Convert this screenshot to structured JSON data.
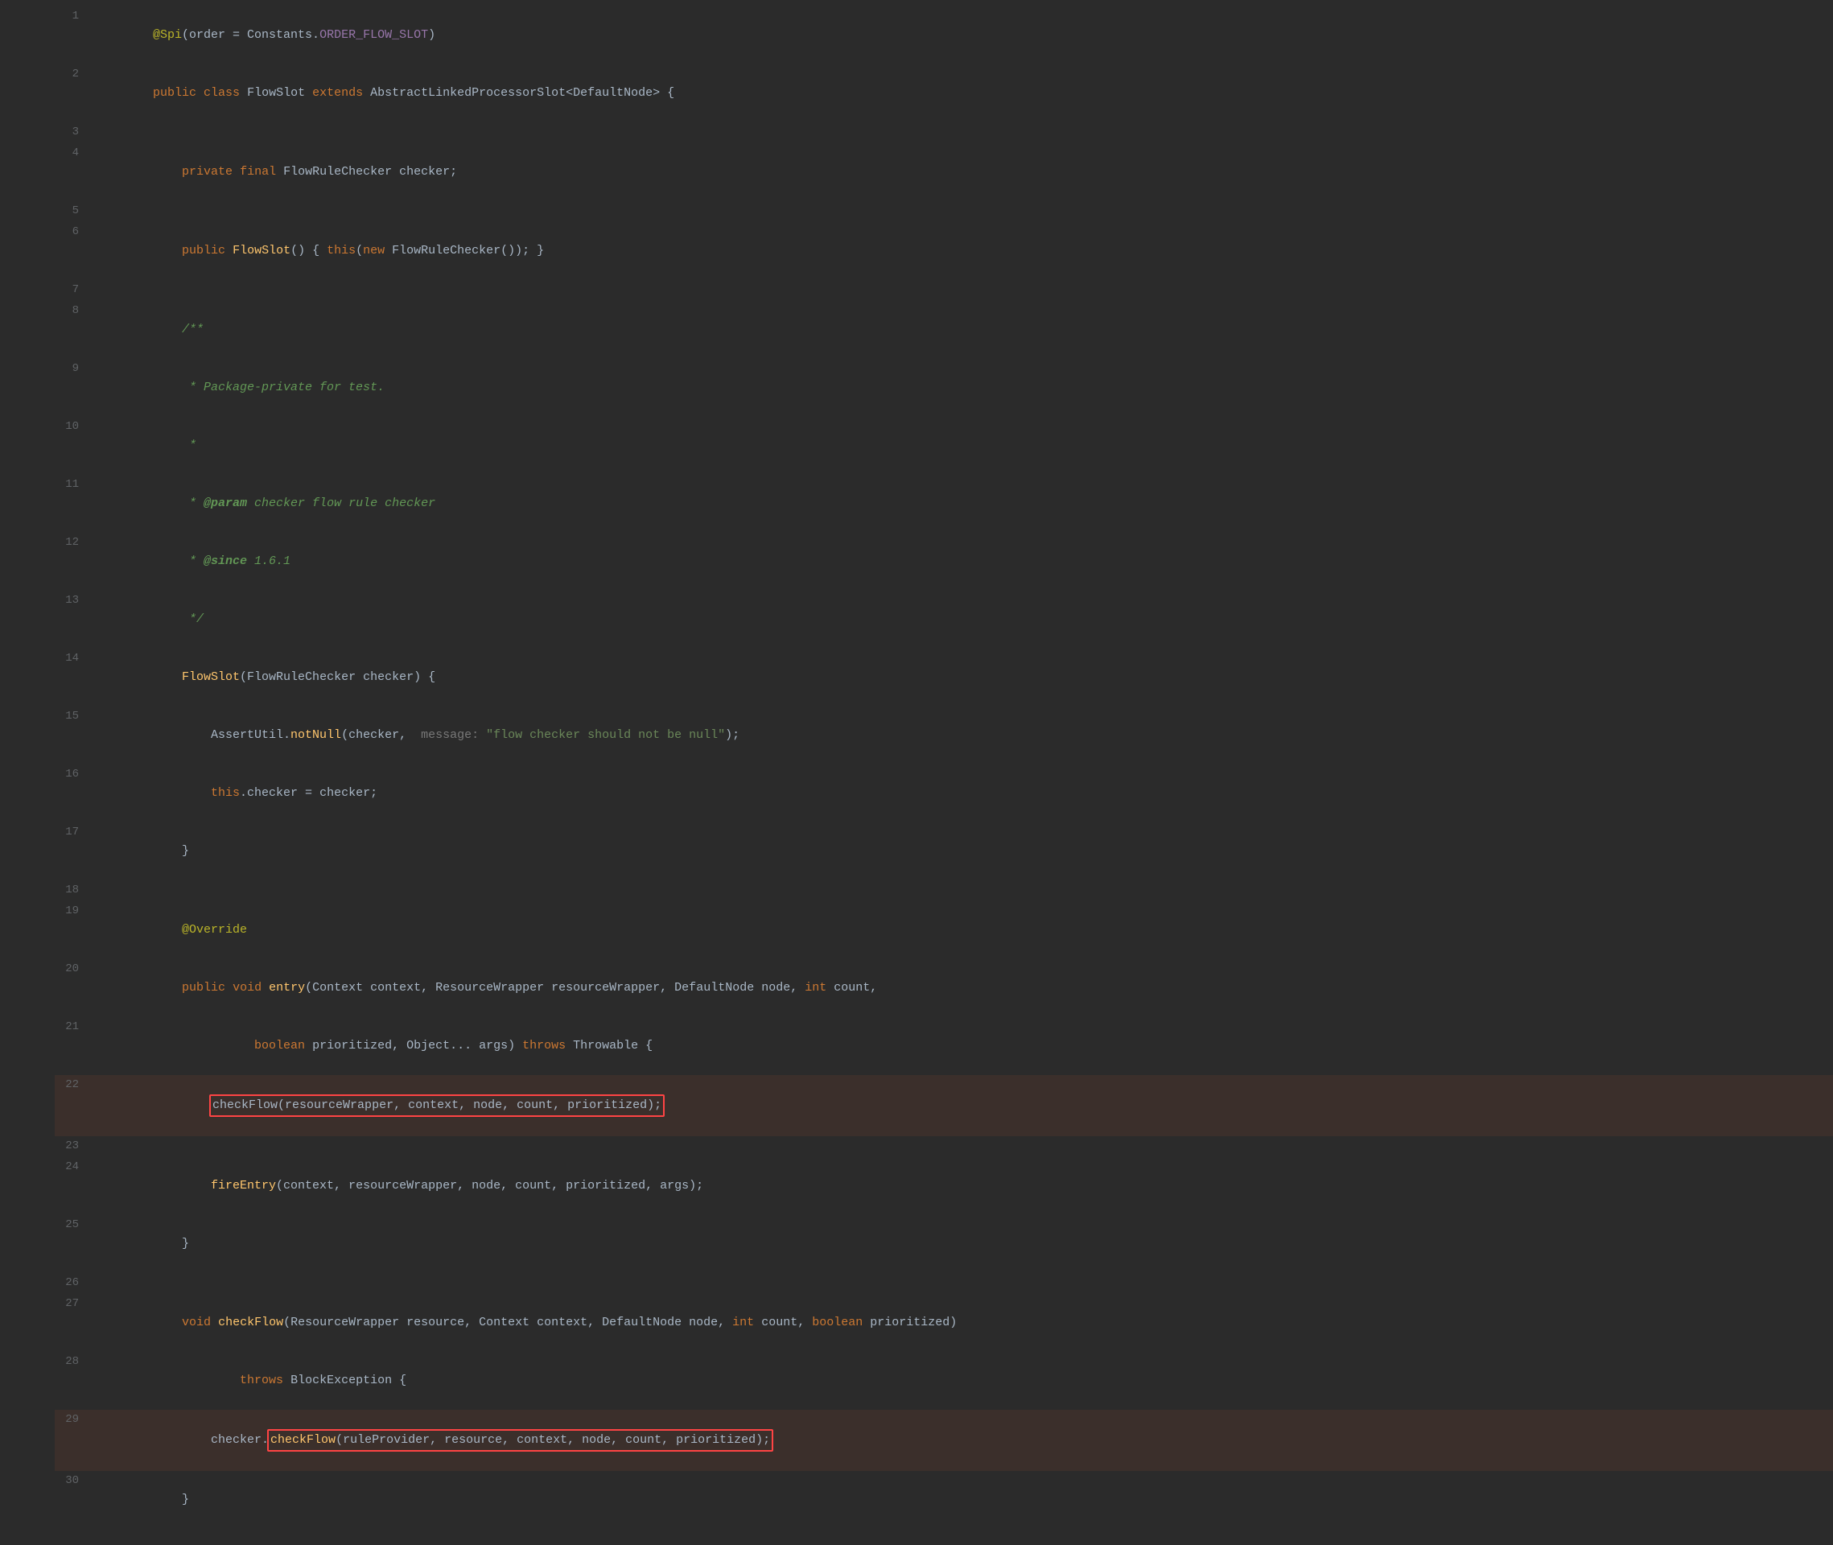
{
  "editor": {
    "background": "#2b2b2b",
    "lines": [
      {
        "num": 1,
        "tokens": [
          {
            "text": "@Spi",
            "cls": "annotation"
          },
          {
            "text": "(order = Constants.",
            "cls": "punctuation"
          },
          {
            "text": "ORDER_FLOW_SLOT",
            "cls": "annotation-param"
          },
          {
            "text": ")",
            "cls": "punctuation"
          }
        ],
        "gutter": "none"
      },
      {
        "num": 2,
        "tokens": [
          {
            "text": "public",
            "cls": "kw"
          },
          {
            "text": " ",
            "cls": ""
          },
          {
            "text": "class",
            "cls": "kw"
          },
          {
            "text": " FlowSlot ",
            "cls": "punctuation"
          },
          {
            "text": "extends",
            "cls": "kw"
          },
          {
            "text": " AbstractLinkedProcessorSlot<DefaultNode> {",
            "cls": "punctuation"
          }
        ],
        "gutter": "fold"
      },
      {
        "num": 3,
        "tokens": [],
        "gutter": "none"
      },
      {
        "num": 4,
        "tokens": [
          {
            "text": "    ",
            "cls": ""
          },
          {
            "text": "private",
            "cls": "kw"
          },
          {
            "text": " ",
            "cls": ""
          },
          {
            "text": "final",
            "cls": "kw"
          },
          {
            "text": " FlowRuleChecker checker;",
            "cls": "punctuation"
          }
        ],
        "gutter": "none"
      },
      {
        "num": 5,
        "tokens": [],
        "gutter": "none"
      },
      {
        "num": 6,
        "tokens": [
          {
            "text": "    ",
            "cls": ""
          },
          {
            "text": "public",
            "cls": "kw"
          },
          {
            "text": " ",
            "cls": ""
          },
          {
            "text": "FlowSlot",
            "cls": "method"
          },
          {
            "text": "() { ",
            "cls": "punctuation"
          },
          {
            "text": "this",
            "cls": "kw"
          },
          {
            "text": "(",
            "cls": "punctuation"
          },
          {
            "text": "new",
            "cls": "kw"
          },
          {
            "text": " FlowRuleChecker()); }",
            "cls": "punctuation"
          }
        ],
        "gutter": "none"
      },
      {
        "num": 7,
        "tokens": [],
        "gutter": "none"
      },
      {
        "num": 8,
        "tokens": [
          {
            "text": "    /**",
            "cls": "comment"
          }
        ],
        "gutter": "fold"
      },
      {
        "num": 9,
        "tokens": [
          {
            "text": "     * Package-private for test.",
            "cls": "comment"
          }
        ],
        "gutter": "none"
      },
      {
        "num": 10,
        "tokens": [
          {
            "text": "     *",
            "cls": "comment"
          }
        ],
        "gutter": "none"
      },
      {
        "num": 11,
        "tokens": [
          {
            "text": "     * ",
            "cls": "comment"
          },
          {
            "text": "@param",
            "cls": "comment-tag"
          },
          {
            "text": " checker flow rule checker",
            "cls": "comment"
          }
        ],
        "gutter": "none"
      },
      {
        "num": 12,
        "tokens": [
          {
            "text": "     * ",
            "cls": "comment"
          },
          {
            "text": "@since",
            "cls": "comment-tag"
          },
          {
            "text": " 1.6.1",
            "cls": "comment"
          }
        ],
        "gutter": "none"
      },
      {
        "num": 13,
        "tokens": [
          {
            "text": "     */",
            "cls": "comment"
          }
        ],
        "gutter": "none"
      },
      {
        "num": 14,
        "tokens": [
          {
            "text": "    FlowSlot",
            "cls": "method"
          },
          {
            "text": "(FlowRuleChecker checker) {",
            "cls": "punctuation"
          }
        ],
        "gutter": "fold"
      },
      {
        "num": 15,
        "tokens": [
          {
            "text": "        AssertUtil.",
            "cls": "punctuation"
          },
          {
            "text": "notNull",
            "cls": "method"
          },
          {
            "text": "(checker,  ",
            "cls": "punctuation"
          },
          {
            "text": "message: ",
            "cls": "param-hint"
          },
          {
            "text": "\"flow checker should not be null\"",
            "cls": "string"
          },
          {
            "text": ");",
            "cls": "punctuation"
          }
        ],
        "gutter": "none"
      },
      {
        "num": 16,
        "tokens": [
          {
            "text": "        ",
            "cls": ""
          },
          {
            "text": "this",
            "cls": "kw"
          },
          {
            "text": ".checker = checker;",
            "cls": "punctuation"
          }
        ],
        "gutter": "none"
      },
      {
        "num": 17,
        "tokens": [
          {
            "text": "    }",
            "cls": "punctuation"
          }
        ],
        "gutter": "none"
      },
      {
        "num": 18,
        "tokens": [],
        "gutter": "none"
      },
      {
        "num": 19,
        "tokens": [
          {
            "text": "    @Override",
            "cls": "annotation"
          }
        ],
        "gutter": "none"
      },
      {
        "num": 20,
        "tokens": [
          {
            "text": "    ",
            "cls": ""
          },
          {
            "text": "public",
            "cls": "kw"
          },
          {
            "text": " ",
            "cls": ""
          },
          {
            "text": "void",
            "cls": "kw"
          },
          {
            "text": " ",
            "cls": ""
          },
          {
            "text": "entry",
            "cls": "method"
          },
          {
            "text": "(Context context, ResourceWrapper resourceWrapper, DefaultNode node, ",
            "cls": "punctuation"
          },
          {
            "text": "int",
            "cls": "int-type"
          },
          {
            "text": " count,",
            "cls": "punctuation"
          }
        ],
        "gutter": "fold"
      },
      {
        "num": 21,
        "tokens": [
          {
            "text": "            ",
            "cls": ""
          },
          {
            "text": "boolean",
            "cls": "kw"
          },
          {
            "text": " prioritized, Object... args) ",
            "cls": "punctuation"
          },
          {
            "text": "throws",
            "cls": "kw"
          },
          {
            "text": " Throwable {",
            "cls": "punctuation"
          }
        ],
        "gutter": "none"
      },
      {
        "num": 22,
        "tokens": [
          {
            "text": "        checkFlow(resourceWrapper, context, node, count, prioritized);",
            "cls": "punctuation",
            "outlined": true
          }
        ],
        "gutter": "none",
        "highlighted": true
      },
      {
        "num": 23,
        "tokens": [],
        "gutter": "none"
      },
      {
        "num": 24,
        "tokens": [
          {
            "text": "        ",
            "cls": ""
          },
          {
            "text": "fireEntry",
            "cls": "method"
          },
          {
            "text": "(context, resourceWrapper, node, count, prioritized, args);",
            "cls": "punctuation"
          }
        ],
        "gutter": "none"
      },
      {
        "num": 25,
        "tokens": [
          {
            "text": "    }",
            "cls": "punctuation"
          }
        ],
        "gutter": "none"
      },
      {
        "num": 26,
        "tokens": [],
        "gutter": "none"
      },
      {
        "num": 27,
        "tokens": [
          {
            "text": "    ",
            "cls": ""
          },
          {
            "text": "void",
            "cls": "kw"
          },
          {
            "text": " ",
            "cls": ""
          },
          {
            "text": "checkFlow",
            "cls": "method"
          },
          {
            "text": "(ResourceWrapper resource, Context context, DefaultNode node, ",
            "cls": "punctuation"
          },
          {
            "text": "int",
            "cls": "int-type"
          },
          {
            "text": " count, ",
            "cls": "punctuation"
          },
          {
            "text": "boolean",
            "cls": "kw"
          },
          {
            "text": " prioritized)",
            "cls": "punctuation"
          }
        ],
        "gutter": "none"
      },
      {
        "num": 28,
        "tokens": [
          {
            "text": "            ",
            "cls": ""
          },
          {
            "text": "throws",
            "cls": "kw"
          },
          {
            "text": " BlockException {",
            "cls": "punctuation"
          }
        ],
        "gutter": "none"
      },
      {
        "num": 29,
        "tokens": [
          {
            "text": "        checker.",
            "cls": "punctuation"
          },
          {
            "text": "checkFlow",
            "cls": "method"
          },
          {
            "text": "(ruleProvider, resource, context, node, count, prioritized);",
            "cls": "punctuation",
            "outlined": true
          }
        ],
        "gutter": "none",
        "highlighted": true
      },
      {
        "num": 30,
        "tokens": [
          {
            "text": "    }",
            "cls": "punctuation"
          }
        ],
        "gutter": "none"
      }
    ]
  }
}
